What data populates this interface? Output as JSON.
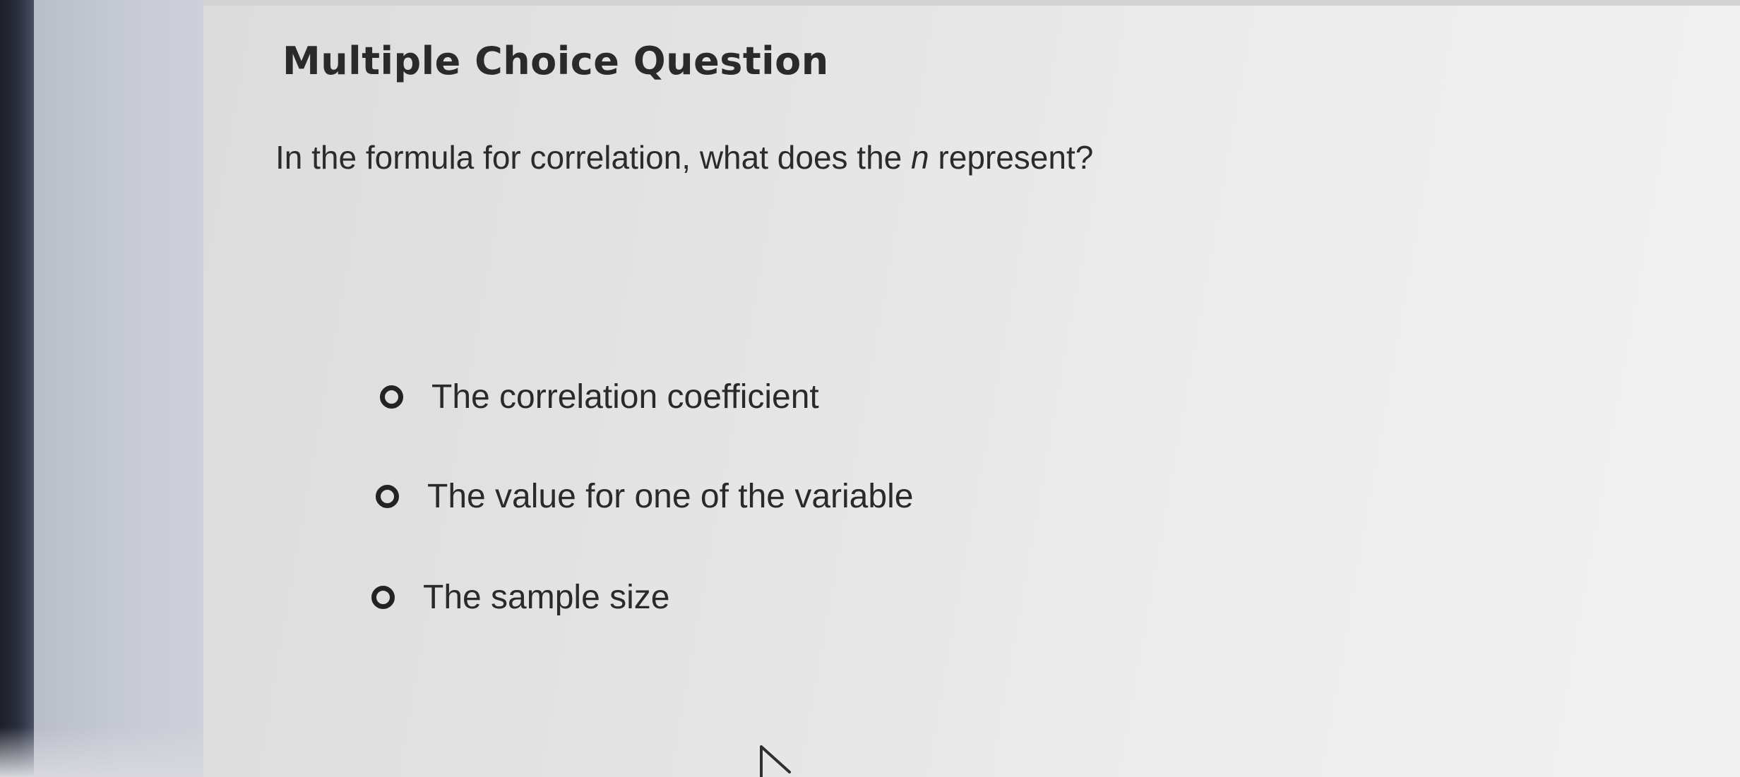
{
  "question": {
    "heading": "Multiple Choice Question",
    "prompt_before": "In the formula for correlation, what does the ",
    "prompt_variable": "n",
    "prompt_after": " represent?"
  },
  "options": [
    {
      "label": "The correlation coefficient",
      "selected": false
    },
    {
      "label": "The value for one of the variable",
      "selected": false
    },
    {
      "label": "The sample size",
      "selected": false
    }
  ],
  "icons": {
    "radio": "radio-unchecked-icon",
    "cursor": "mouse-pointer-icon"
  },
  "colors": {
    "text": "#2a2a2a",
    "radio_border": "#232323",
    "page_background": "#e9e9e9",
    "side_panel": "#c6cad4"
  }
}
